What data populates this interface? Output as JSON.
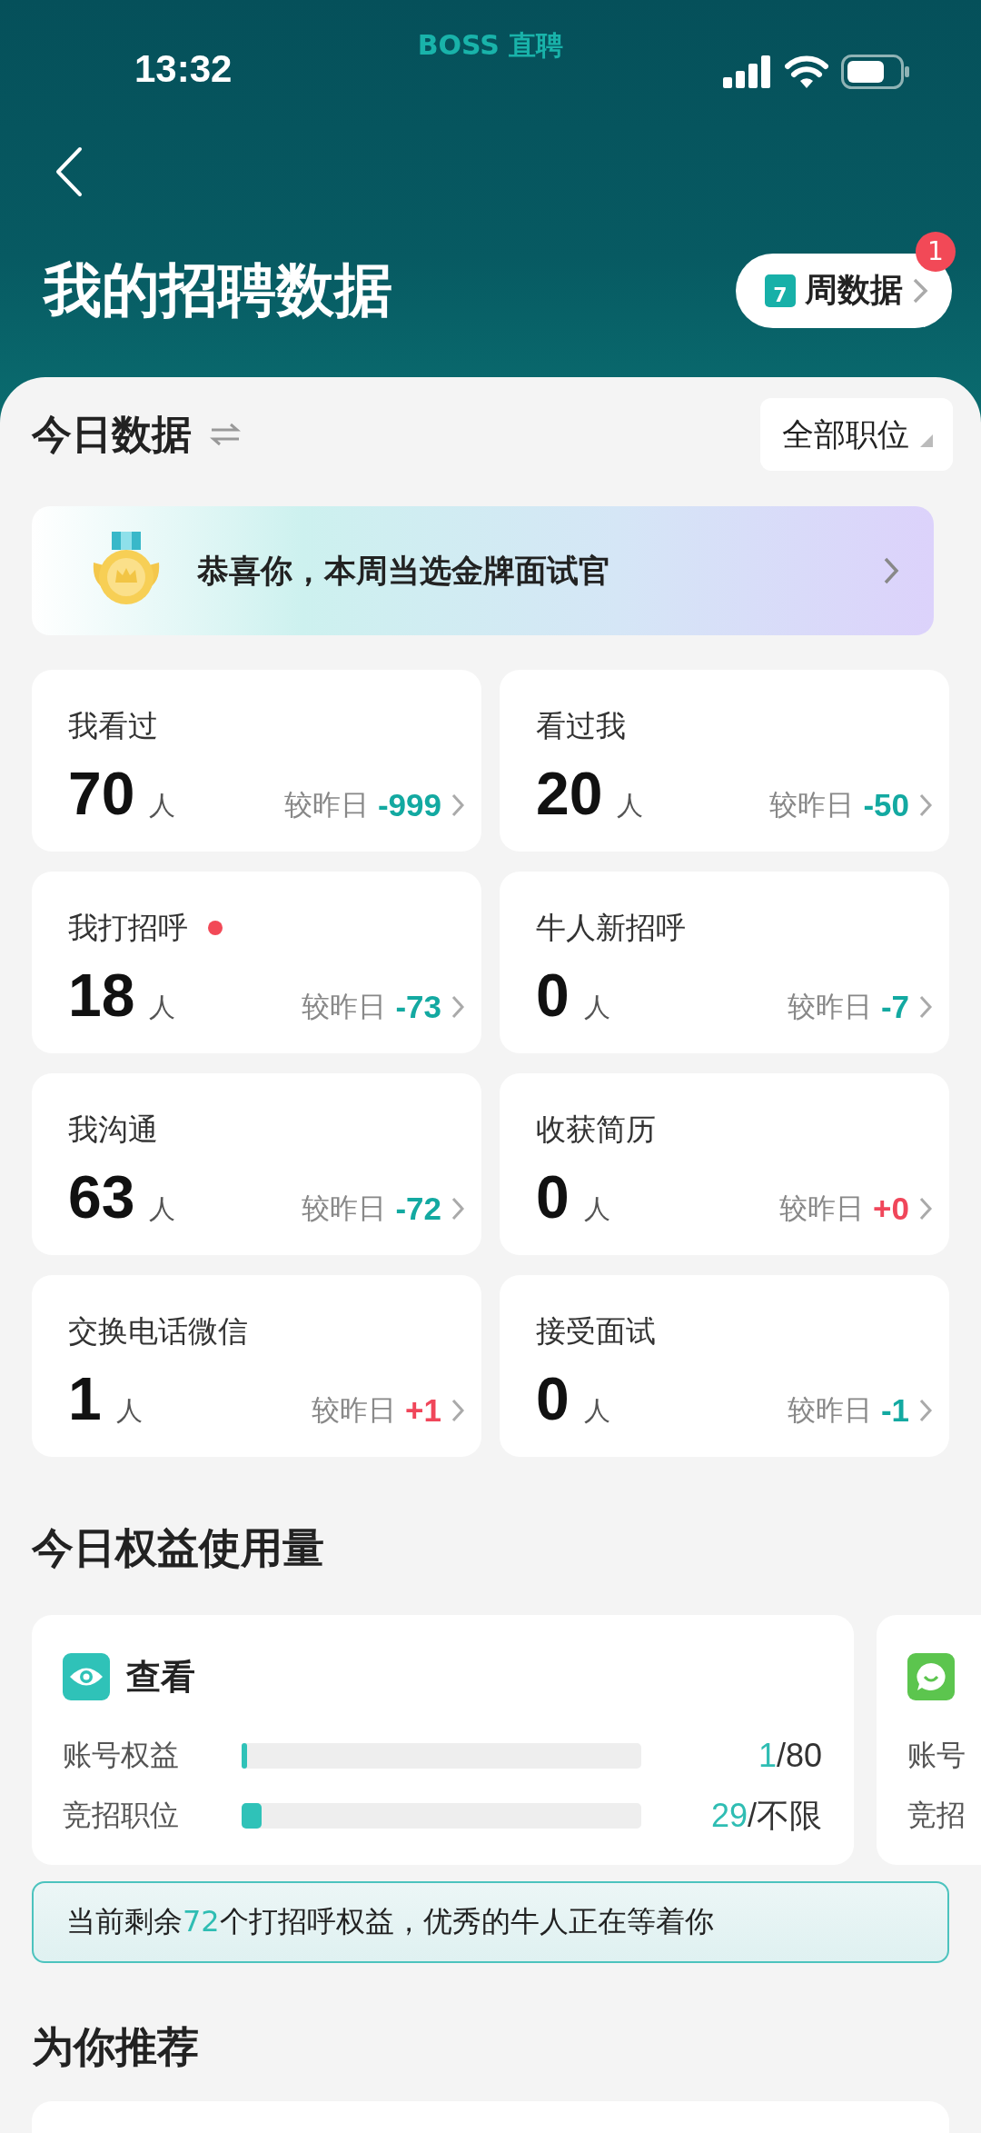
{
  "status_bar": {
    "time": "13:32",
    "brand": "BOSS 直聘"
  },
  "header": {
    "title": "我的招聘数据",
    "week_button": {
      "calendar_day": "7",
      "label": "周数据",
      "badge": "1"
    }
  },
  "today": {
    "title": "今日数据",
    "filter": "全部职位",
    "banner": "恭喜你，本周当选金牌面试官",
    "stats": [
      {
        "label": "我看过",
        "dot": false,
        "value": "70",
        "unit": "人",
        "compare": "较昨日",
        "change": "-999",
        "kind": "down"
      },
      {
        "label": "看过我",
        "dot": false,
        "value": "20",
        "unit": "人",
        "compare": "较昨日",
        "change": "-50",
        "kind": "down"
      },
      {
        "label": "我打招呼",
        "dot": true,
        "value": "18",
        "unit": "人",
        "compare": "较昨日",
        "change": "-73",
        "kind": "down"
      },
      {
        "label": "牛人新招呼",
        "dot": false,
        "value": "0",
        "unit": "人",
        "compare": "较昨日",
        "change": "-7",
        "kind": "down"
      },
      {
        "label": "我沟通",
        "dot": false,
        "value": "63",
        "unit": "人",
        "compare": "较昨日",
        "change": "-72",
        "kind": "down"
      },
      {
        "label": "收获简历",
        "dot": false,
        "value": "0",
        "unit": "人",
        "compare": "较昨日",
        "change": "+0",
        "kind": "up"
      },
      {
        "label": "交换电话微信",
        "dot": false,
        "value": "1",
        "unit": "人",
        "compare": "较昨日",
        "change": "+1",
        "kind": "up"
      },
      {
        "label": "接受面试",
        "dot": false,
        "value": "0",
        "unit": "人",
        "compare": "较昨日",
        "change": "-1",
        "kind": "down"
      }
    ]
  },
  "benefits": {
    "title": "今日权益使用量",
    "cards": [
      {
        "kind": "view",
        "title": "查看",
        "rows": [
          {
            "label": "账号权益",
            "used": "1",
            "total": "/80",
            "level": 0.0125
          },
          {
            "label": "竞招职位",
            "used": "29",
            "total": "/不限",
            "level": 0.05
          }
        ]
      },
      {
        "kind": "chat",
        "rows": [
          {
            "label": "账号"
          },
          {
            "label": "竞招"
          }
        ]
      }
    ],
    "notice": {
      "before": "当前剩余",
      "highlight": "72",
      "after": "个打招呼权益，优秀的牛人正在等着你"
    }
  },
  "recommend": {
    "title": "为你推荐"
  }
}
